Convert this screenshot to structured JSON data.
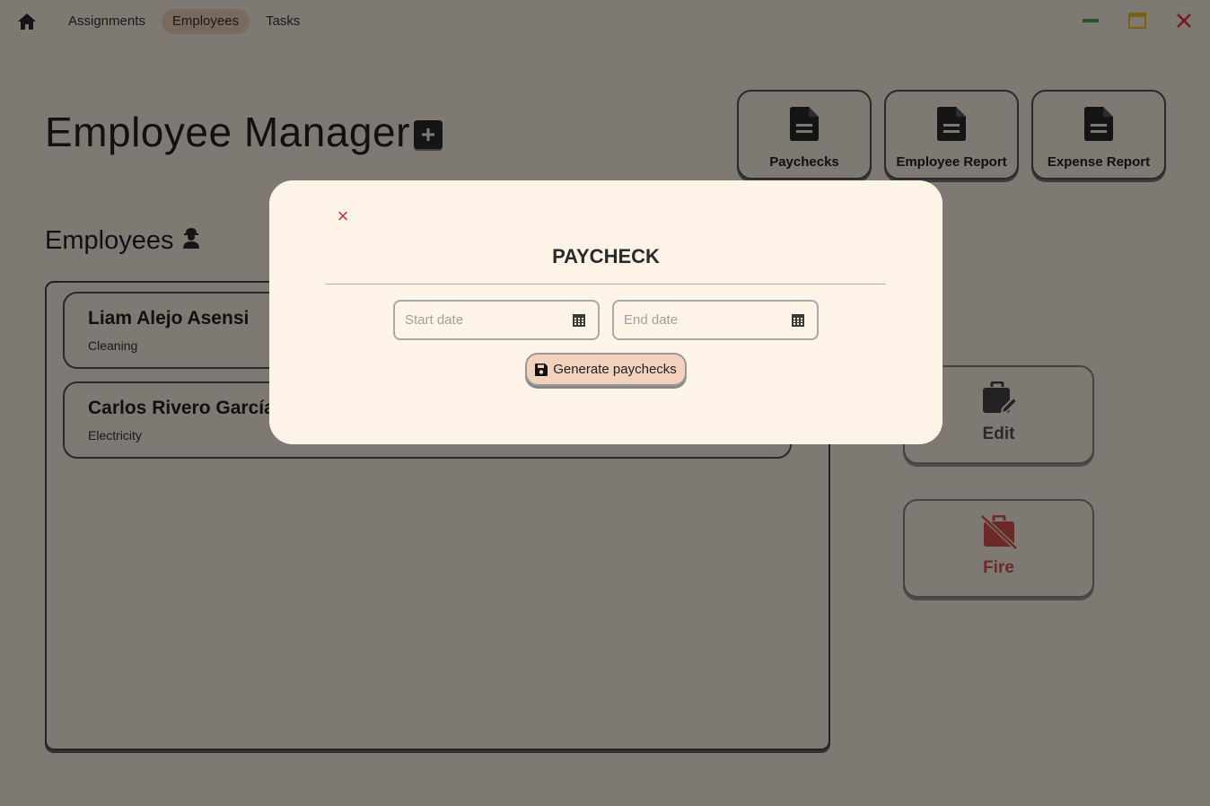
{
  "nav": {
    "items": [
      {
        "label": "Assignments"
      },
      {
        "label": "Employees"
      },
      {
        "label": "Tasks"
      }
    ],
    "active_index": 1
  },
  "window_controls": {
    "minimize_color": "#4caf50",
    "maximize_color": "#f5c518",
    "close_color": "#e53935"
  },
  "header": {
    "title": "Employee Manager"
  },
  "reports": [
    {
      "label": "Paychecks",
      "icon": "document-icon"
    },
    {
      "label": "Employee Report",
      "icon": "document-icon"
    },
    {
      "label": "Expense Report",
      "icon": "document-icon"
    }
  ],
  "employees_section": {
    "title": "Employees",
    "icon": "worker-icon"
  },
  "employees": [
    {
      "name": "Liam Alejo Asensi",
      "role": "Cleaning"
    },
    {
      "name": "Carlos Rivero García",
      "role": "Electricity"
    }
  ],
  "side_actions": {
    "edit_label": "Edit",
    "fire_label": "Fire"
  },
  "modal": {
    "title": "PAYCHECK",
    "start_placeholder": "Start date",
    "end_placeholder": "End date",
    "generate_label": "Generate paychecks",
    "close_glyph": "×"
  },
  "colors": {
    "background": "#fdf3e6",
    "accent": "#f3d2bd",
    "danger": "#c0392b"
  }
}
